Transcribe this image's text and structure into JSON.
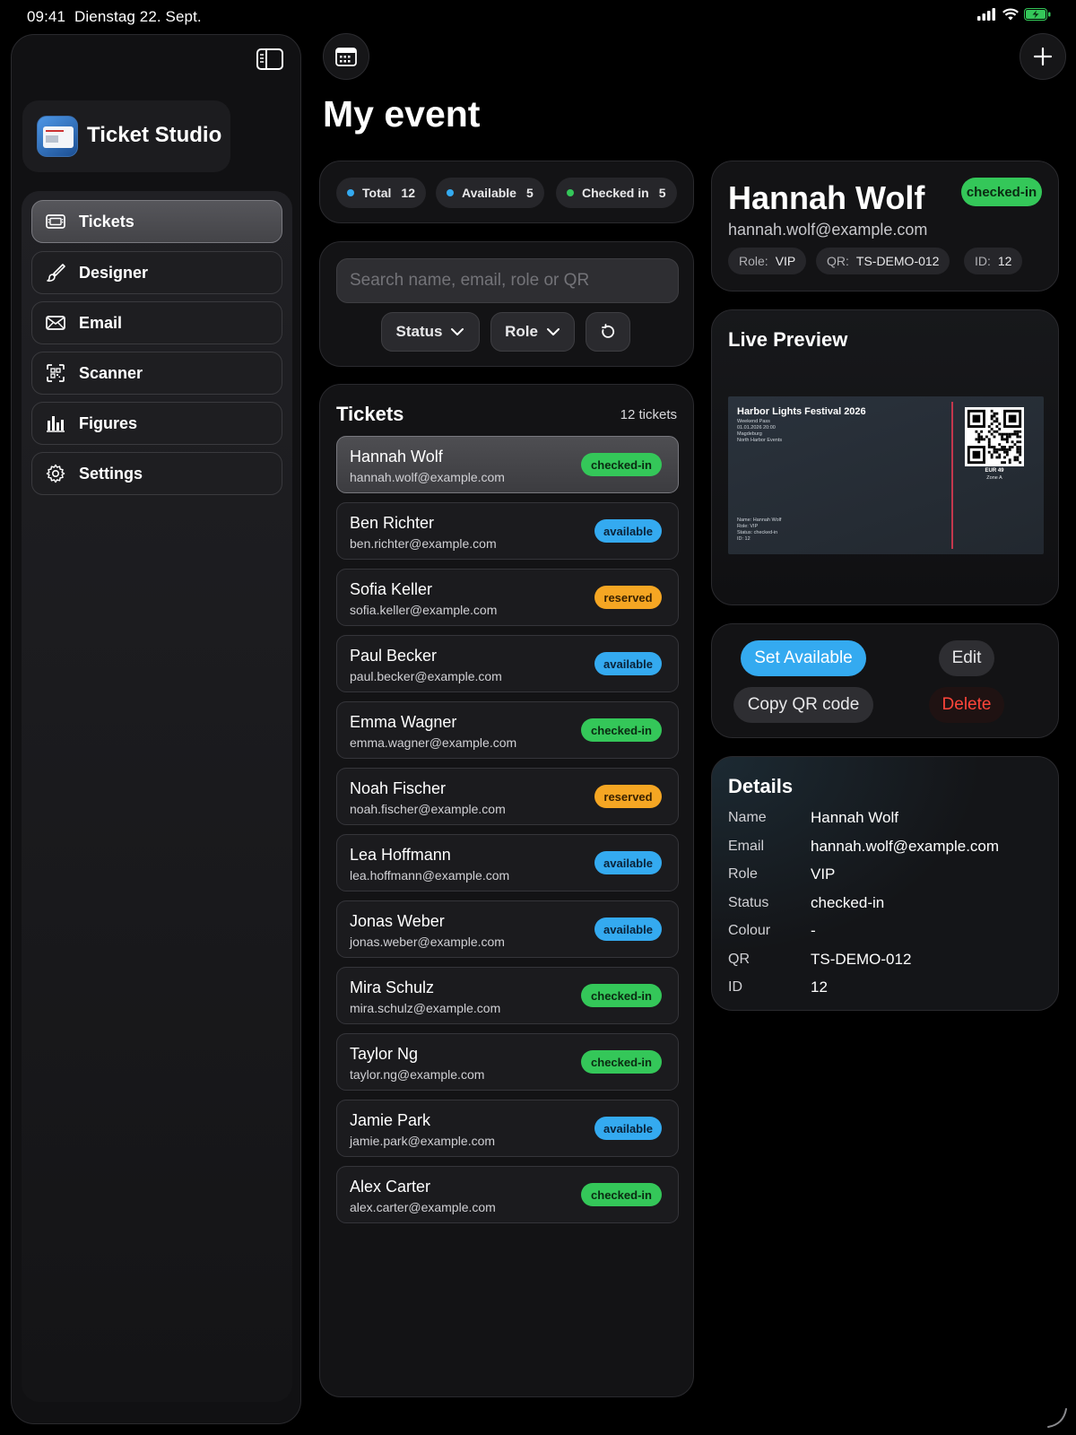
{
  "status_bar": {
    "time": "09:41",
    "date": "Dienstag 22. Sept."
  },
  "app": {
    "name": "Ticket Studio"
  },
  "sidebar": {
    "items": [
      {
        "label": "Tickets",
        "icon": "ticket-icon",
        "active": true
      },
      {
        "label": "Designer",
        "icon": "brush-icon",
        "active": false
      },
      {
        "label": "Email",
        "icon": "envelope-icon",
        "active": false
      },
      {
        "label": "Scanner",
        "icon": "qr-scan-icon",
        "active": false
      },
      {
        "label": "Figures",
        "icon": "bar-chart-icon",
        "active": false
      },
      {
        "label": "Settings",
        "icon": "gear-icon",
        "active": false
      }
    ]
  },
  "page": {
    "title": "My event"
  },
  "stats": {
    "total_label": "Total",
    "total": "12",
    "available_label": "Available",
    "available": "5",
    "checked_label": "Checked in",
    "checked": "5"
  },
  "filters": {
    "search_placeholder": "Search name, email, role or QR",
    "status_label": "Status",
    "role_label": "Role"
  },
  "tickets": {
    "title": "Tickets",
    "count_label": "12 tickets",
    "rows": [
      {
        "name": "Hannah Wolf",
        "email": "hannah.wolf@example.com",
        "status": "checked-in"
      },
      {
        "name": "Ben Richter",
        "email": "ben.richter@example.com",
        "status": "available"
      },
      {
        "name": "Sofia Keller",
        "email": "sofia.keller@example.com",
        "status": "reserved"
      },
      {
        "name": "Paul Becker",
        "email": "paul.becker@example.com",
        "status": "available"
      },
      {
        "name": "Emma Wagner",
        "email": "emma.wagner@example.com",
        "status": "checked-in"
      },
      {
        "name": "Noah Fischer",
        "email": "noah.fischer@example.com",
        "status": "reserved"
      },
      {
        "name": "Lea Hoffmann",
        "email": "lea.hoffmann@example.com",
        "status": "available"
      },
      {
        "name": "Jonas Weber",
        "email": "jonas.weber@example.com",
        "status": "available"
      },
      {
        "name": "Mira Schulz",
        "email": "mira.schulz@example.com",
        "status": "checked-in"
      },
      {
        "name": "Taylor Ng",
        "email": "taylor.ng@example.com",
        "status": "checked-in"
      },
      {
        "name": "Jamie Park",
        "email": "jamie.park@example.com",
        "status": "available"
      },
      {
        "name": "Alex Carter",
        "email": "alex.carter@example.com",
        "status": "checked-in"
      }
    ]
  },
  "selected": {
    "name": "Hannah Wolf",
    "email": "hannah.wolf@example.com",
    "status": "checked-in",
    "role_key": "Role:",
    "role": "VIP",
    "qr_key": "QR:",
    "qr": "TS-DEMO-012",
    "id_key": "ID:",
    "id": "12"
  },
  "preview": {
    "title": "Live Preview",
    "event_title": "Harbor Lights Festival 2026",
    "pass": "Weekend Pass",
    "datetime": "01.01.2026 20:00",
    "city": "Magdeburg",
    "organizer": "North Harbor Events",
    "holder_name": "Name: Hannah Wolf",
    "holder_role": "Role: VIP",
    "holder_status": "Status: checked-in",
    "holder_id": "ID: 12",
    "price": "EUR 49",
    "zone": "Zone A"
  },
  "actions": {
    "set_available": "Set Available",
    "edit": "Edit",
    "copy_qr": "Copy QR code",
    "delete": "Delete"
  },
  "details": {
    "title": "Details",
    "rows": [
      {
        "key": "Name",
        "value": "Hannah Wolf"
      },
      {
        "key": "Email",
        "value": "hannah.wolf@example.com"
      },
      {
        "key": "Role",
        "value": "VIP"
      },
      {
        "key": "Status",
        "value": "checked-in"
      },
      {
        "key": "Colour",
        "value": "-"
      },
      {
        "key": "QR",
        "value": "TS-DEMO-012"
      },
      {
        "key": "ID",
        "value": "12"
      }
    ]
  },
  "colors": {
    "checked": "#34c759",
    "available": "#34aaf0",
    "reserved": "#f5a623",
    "delete": "#ff453a"
  }
}
